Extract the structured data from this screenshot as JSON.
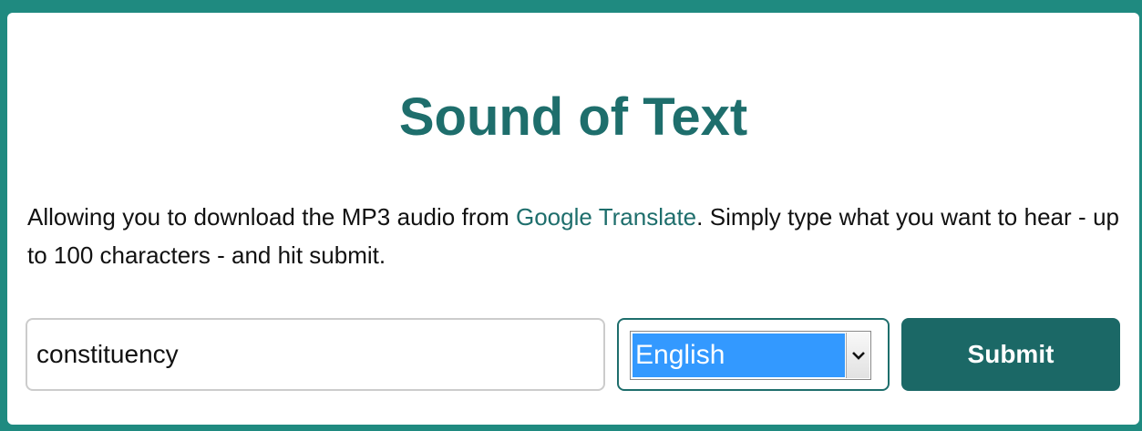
{
  "page": {
    "title": "Sound of Text"
  },
  "description": {
    "before_link": "Allowing you to download the MP3 audio from ",
    "link_text": "Google Translate",
    "after_link": ". Simply type what you want to hear - up to 100 characters - and hit submit."
  },
  "form": {
    "text_value": "constituency",
    "language_selected": "English",
    "submit_label": "Submit"
  },
  "icons": {
    "select_arrow": "chevron-down-icon"
  },
  "colors": {
    "accent": "#1e6e6c",
    "button": "#1b6866",
    "border_frame": "#1f8a80",
    "selection_highlight": "#3399ff"
  }
}
